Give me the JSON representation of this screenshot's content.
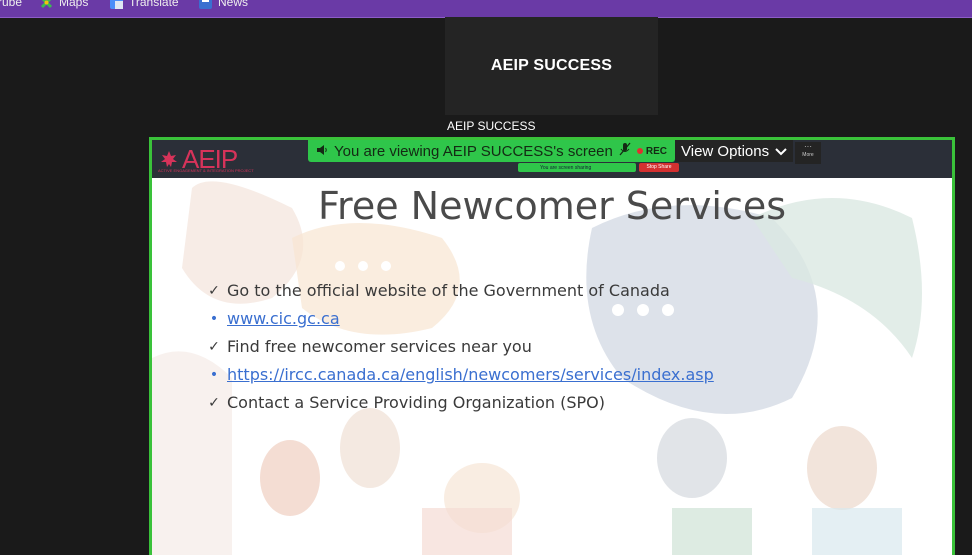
{
  "bookmarks": [
    {
      "label": "rube",
      "icon": "youtube-icon"
    },
    {
      "label": "Maps",
      "icon": "maps-icon"
    },
    {
      "label": "Translate",
      "icon": "translate-icon"
    },
    {
      "label": "News",
      "icon": "news-icon"
    }
  ],
  "participant": {
    "tile_name": "AEIP SUCCESS",
    "caption": "AEIP SUCCESS"
  },
  "share_toolbar": {
    "banner_text": "You are viewing AEIP SUCCESS's screen",
    "rec_label": "REC",
    "view_options_label": "View Options",
    "more_label": "More",
    "mini_status": "You are screen sharing",
    "mini_stop": "Stop Share"
  },
  "slide": {
    "logo_text": "AEIP",
    "logo_subtitle": "ACTIVE ENGAGEMENT & INTEGRATION PROJECT",
    "title": "Free Newcomer Services",
    "items": [
      {
        "type": "check",
        "text": "Go to the official website of the Government of Canada"
      },
      {
        "type": "link",
        "text": "www.cic.gc.ca"
      },
      {
        "type": "check",
        "text": "Find free newcomer services near you"
      },
      {
        "type": "link",
        "text": "https://ircc.canada.ca/english/newcomers/services/index.asp"
      },
      {
        "type": "check",
        "text": "Contact a Service Providing Organization (SPO)"
      }
    ]
  },
  "colors": {
    "share_border": "#3ac23a",
    "banner": "#2fc64a",
    "link": "#3a6fd0",
    "bookmarks_bar": "#6a3aa6"
  }
}
